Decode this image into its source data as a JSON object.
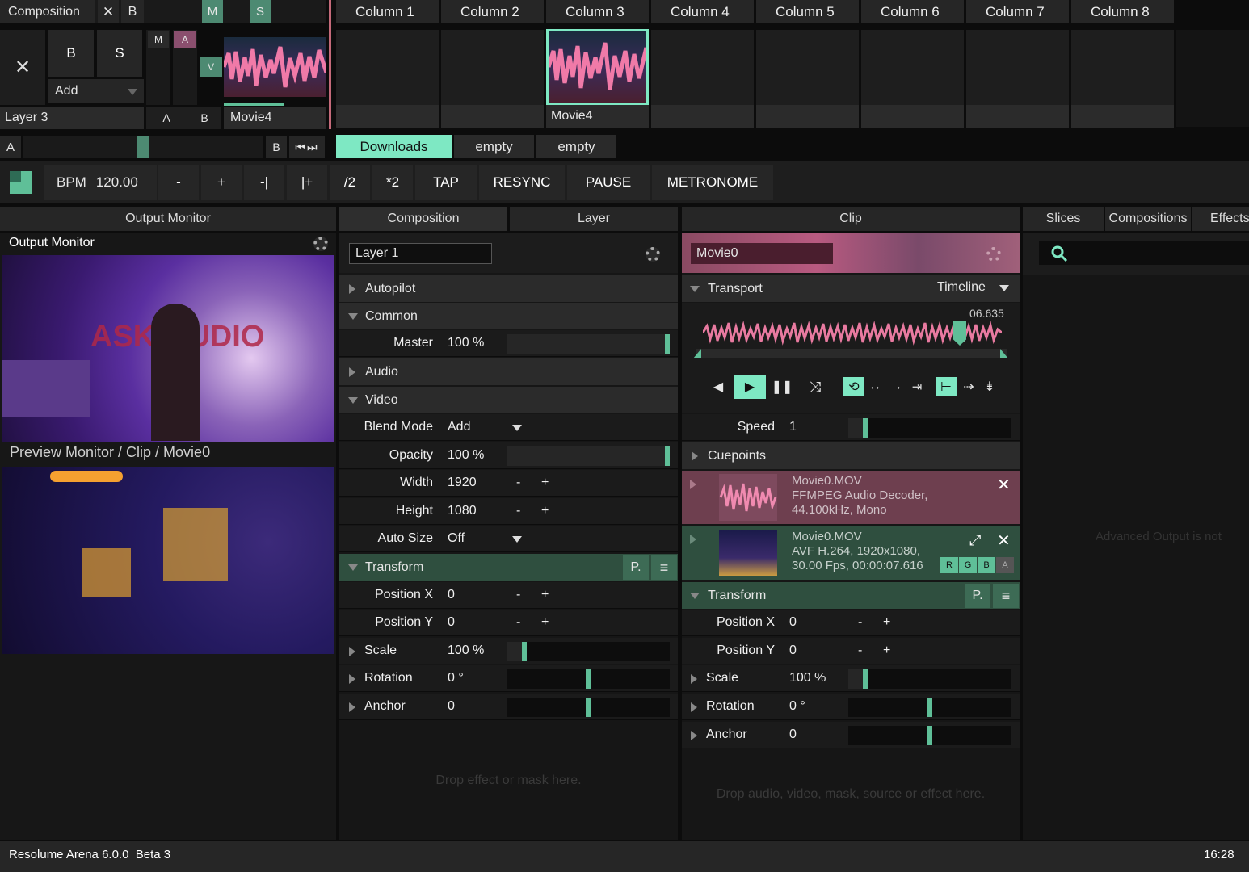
{
  "top": {
    "composition_label": "Composition",
    "x_label": "✕",
    "b_label": "B",
    "m_label": "M",
    "s_label": "S",
    "layer_b": "B",
    "layer_s": "S",
    "layer_m": "M",
    "layer_a": "A",
    "layer_v": "V",
    "add_label": "Add",
    "layer_name": "Layer 3",
    "ab_a": "A",
    "ab_b": "B",
    "clip1_label": "Movie4"
  },
  "columns": [
    "Column 1",
    "Column 2",
    "Column 3",
    "Column 4",
    "Column 5",
    "Column 6",
    "Column 7",
    "Column 8"
  ],
  "active_column": 2,
  "grid_clip": {
    "label": "Movie4"
  },
  "crossfader": {
    "a": "A",
    "b": "B"
  },
  "decks": [
    "Downloads",
    "empty",
    "empty"
  ],
  "transport_bar": {
    "bpm_label": "BPM",
    "bpm_value": "120.00",
    "minus": "-",
    "plus": "+",
    "nudge_minus": "-|",
    "nudge_plus": "|+",
    "half": "/2",
    "double": "*2",
    "tap": "TAP",
    "resync": "RESYNC",
    "pause": "PAUSE",
    "metronome": "METRONOME"
  },
  "output_monitor": {
    "tab": "Output Monitor",
    "title": "Output Monitor",
    "preview_caption": "Preview Monitor / Clip / Movie0"
  },
  "middle": {
    "tabs": [
      "Composition",
      "Layer"
    ],
    "layer_field": "Layer 1",
    "autopilot": "Autopilot",
    "common": "Common",
    "master_label": "Master",
    "master_value": "100 %",
    "audio": "Audio",
    "video": "Video",
    "blend_label": "Blend Mode",
    "blend_value": "Add",
    "opacity_label": "Opacity",
    "opacity_value": "100 %",
    "width_label": "Width",
    "width_value": "1920",
    "height_label": "Height",
    "height_value": "1080",
    "autosize_label": "Auto Size",
    "autosize_value": "Off",
    "transform": "Transform",
    "p_label": "P.",
    "posx_label": "Position X",
    "posx_value": "0",
    "posy_label": "Position Y",
    "posy_value": "0",
    "scale_label": "Scale",
    "scale_value": "100 %",
    "rotation_label": "Rotation",
    "rotation_value": "0 °",
    "anchor_label": "Anchor",
    "anchor_value": "0",
    "drop_hint": "Drop effect or mask here.",
    "minus": "-",
    "plus": "+"
  },
  "clip": {
    "tab": "Clip",
    "name": "Movie0",
    "transport": "Transport",
    "timeline": "Timeline",
    "time": "06.635",
    "speed_label": "Speed",
    "speed_value": "1",
    "cuepoints": "Cuepoints",
    "audio_file": "Movie0.MOV",
    "audio_line1": "FFMPEG Audio Decoder,",
    "audio_line2": "44.100kHz, Mono",
    "video_file": "Movie0.MOV",
    "video_line1": "AVF H.264, 1920x1080,",
    "video_line2": "30.00 Fps, 00:00:07.616",
    "rgba": [
      "R",
      "G",
      "B",
      "A"
    ],
    "transform": "Transform",
    "p_label": "P.",
    "posx_label": "Position X",
    "posx_value": "0",
    "posy_label": "Position Y",
    "posy_value": "0",
    "scale_label": "Scale",
    "scale_value": "100 %",
    "rotation_label": "Rotation",
    "rotation_value": "0 °",
    "anchor_label": "Anchor",
    "anchor_value": "0",
    "drop_hint": "Drop audio, video, mask, source or effect here.",
    "minus": "-",
    "plus": "+"
  },
  "right": {
    "tabs": [
      "Slices",
      "Compositions",
      "Effects"
    ],
    "notice": "Advanced Output is not"
  },
  "status": {
    "app": "Resolume Arena 6.0.0  Beta 3",
    "time": "16:28"
  },
  "colors": {
    "accent": "#7ee8c3",
    "accent_dark": "#4d8a72",
    "clip_bg": "#6e3f4f"
  }
}
